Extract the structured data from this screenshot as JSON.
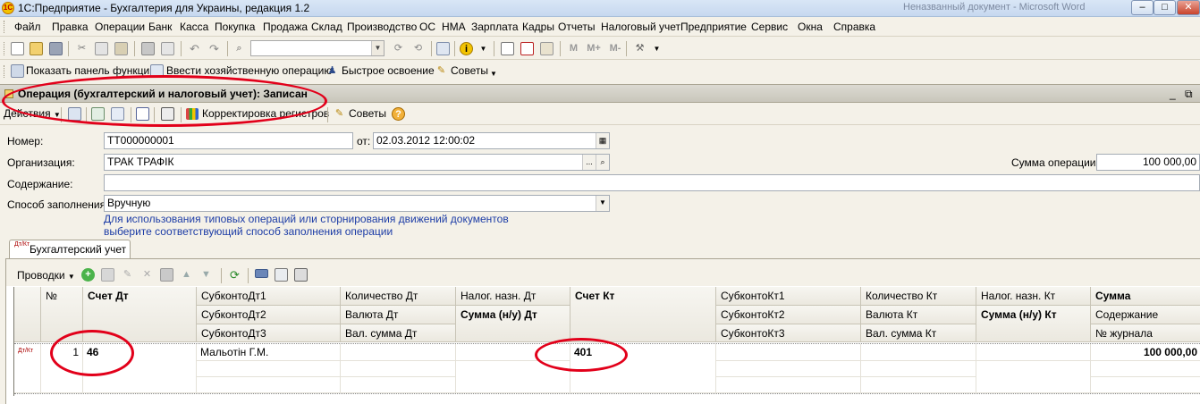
{
  "window": {
    "title": "1С:Предприятие - Бухгалтерия для Украины, редакция 1.2",
    "faded_title": "Неназванный документ - Microsoft Word",
    "minimize": "–",
    "maximize": "□",
    "close": "✕"
  },
  "menu": [
    "Файл",
    "Правка",
    "Операции",
    "Банк",
    "Касса",
    "Покупка",
    "Продажа",
    "Склад",
    "Производство",
    "ОС",
    "НМА",
    "Зарплата",
    "Кадры",
    "Отчеты",
    "Налоговый учет",
    "Предприятие",
    "Сервис",
    "Окна",
    "Справка"
  ],
  "toolbar2": {
    "show_panel": "Показать панель функций",
    "enter_operation": "Ввести хозяйственную операцию",
    "quick_learn": "Быстрое освоение",
    "tips": "Советы"
  },
  "document": {
    "title": "Операция (бухгалтерский и налоговый учет): Записан",
    "actions": "Действия",
    "correct_registers": "Корректировка регистров",
    "tips": "Советы",
    "help_icon": "?"
  },
  "form": {
    "number_label": "Номер:",
    "number_value": "ТТ000000001",
    "from_label": "от:",
    "date_value": "02.03.2012 12:00:02",
    "org_label": "Организация:",
    "org_value": "ТРАК ТРАФІК",
    "org_btn": "...",
    "sum_label": "Сумма операции:",
    "sum_value": "100 000,00",
    "content_label": "Содержание:",
    "content_value": "",
    "fill_label": "Способ заполнения:",
    "fill_value": "Вручную",
    "hint_line1": "Для использования типовых операций или сторнирования движений документов",
    "hint_line2": "выберите соответствующий способ заполнения операции"
  },
  "tab": {
    "label": "Бухгалтерский учет"
  },
  "grid": {
    "toolbar_label": "Проводки",
    "headers": {
      "num": "№",
      "dt_account": "Счет Дт",
      "sub_dt1": "СубконтоДт1",
      "sub_dt2": "СубконтоДт2",
      "sub_dt3": "СубконтоДт3",
      "qty_dt": "Количество Дт",
      "cur_dt": "Валюта Дт",
      "cursum_dt": "Вал. сумма Дт",
      "tax_dt": "Налог. назн. Дт",
      "sum_nu_dt": "Сумма (н/у) Дт",
      "kt_account": "Счет Кт",
      "sub_kt1": "СубконтоКт1",
      "sub_kt2": "СубконтоКт2",
      "sub_kt3": "СубконтоКт3",
      "qty_kt": "Количество Кт",
      "cur_kt": "Валюта Кт",
      "cursum_kt": "Вал. сумма Кт",
      "tax_kt": "Налог. назн. Кт",
      "sum_nu_kt": "Сумма (н/у) Кт",
      "sum": "Сумма",
      "content": "Содержание",
      "journal": "№ журнала"
    },
    "rows": [
      {
        "num": "1",
        "dt_account": "46",
        "sub_dt1": "Мальотін Г.М.",
        "kt_account": "401",
        "sum": "100 000,00"
      }
    ]
  },
  "icons": {
    "tab_icon": "Дт/Кт",
    "row_icon": "Дт/Кт"
  }
}
